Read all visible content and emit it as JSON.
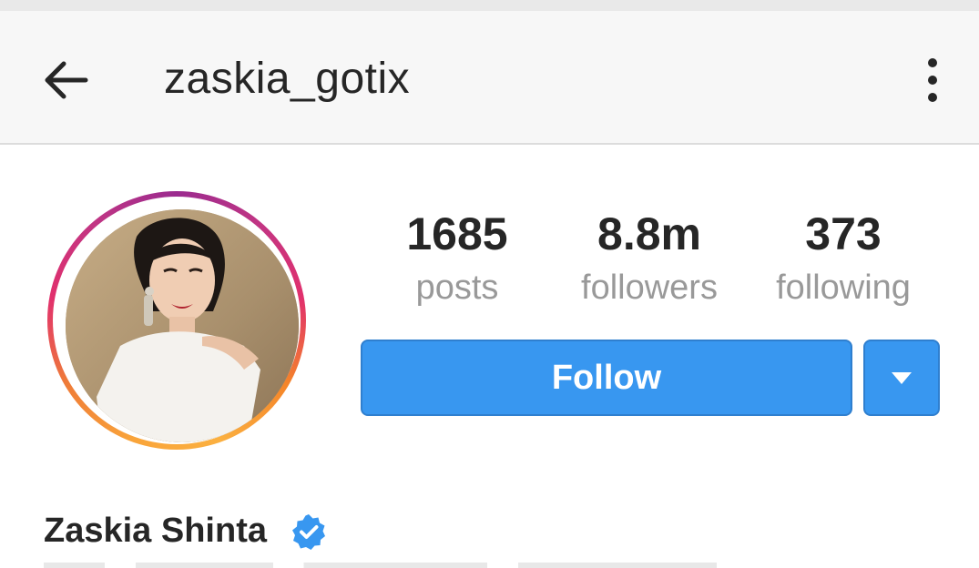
{
  "header": {
    "username": "zaskia_gotix",
    "back_icon": "arrow-left-icon",
    "more_icon": "more-vertical-icon"
  },
  "profile": {
    "avatar_icon": "profile-avatar",
    "full_name": "Zaskia Shinta",
    "verified_icon": "verified-badge-icon",
    "verified_color": "#3897f0"
  },
  "stats": [
    {
      "value": "1685",
      "label": "posts"
    },
    {
      "value": "8.8m",
      "label": "followers"
    },
    {
      "value": "373",
      "label": "following"
    }
  ],
  "actions": {
    "follow_label": "Follow",
    "dropdown_icon": "caret-down-icon",
    "accent": "#3897f0"
  }
}
